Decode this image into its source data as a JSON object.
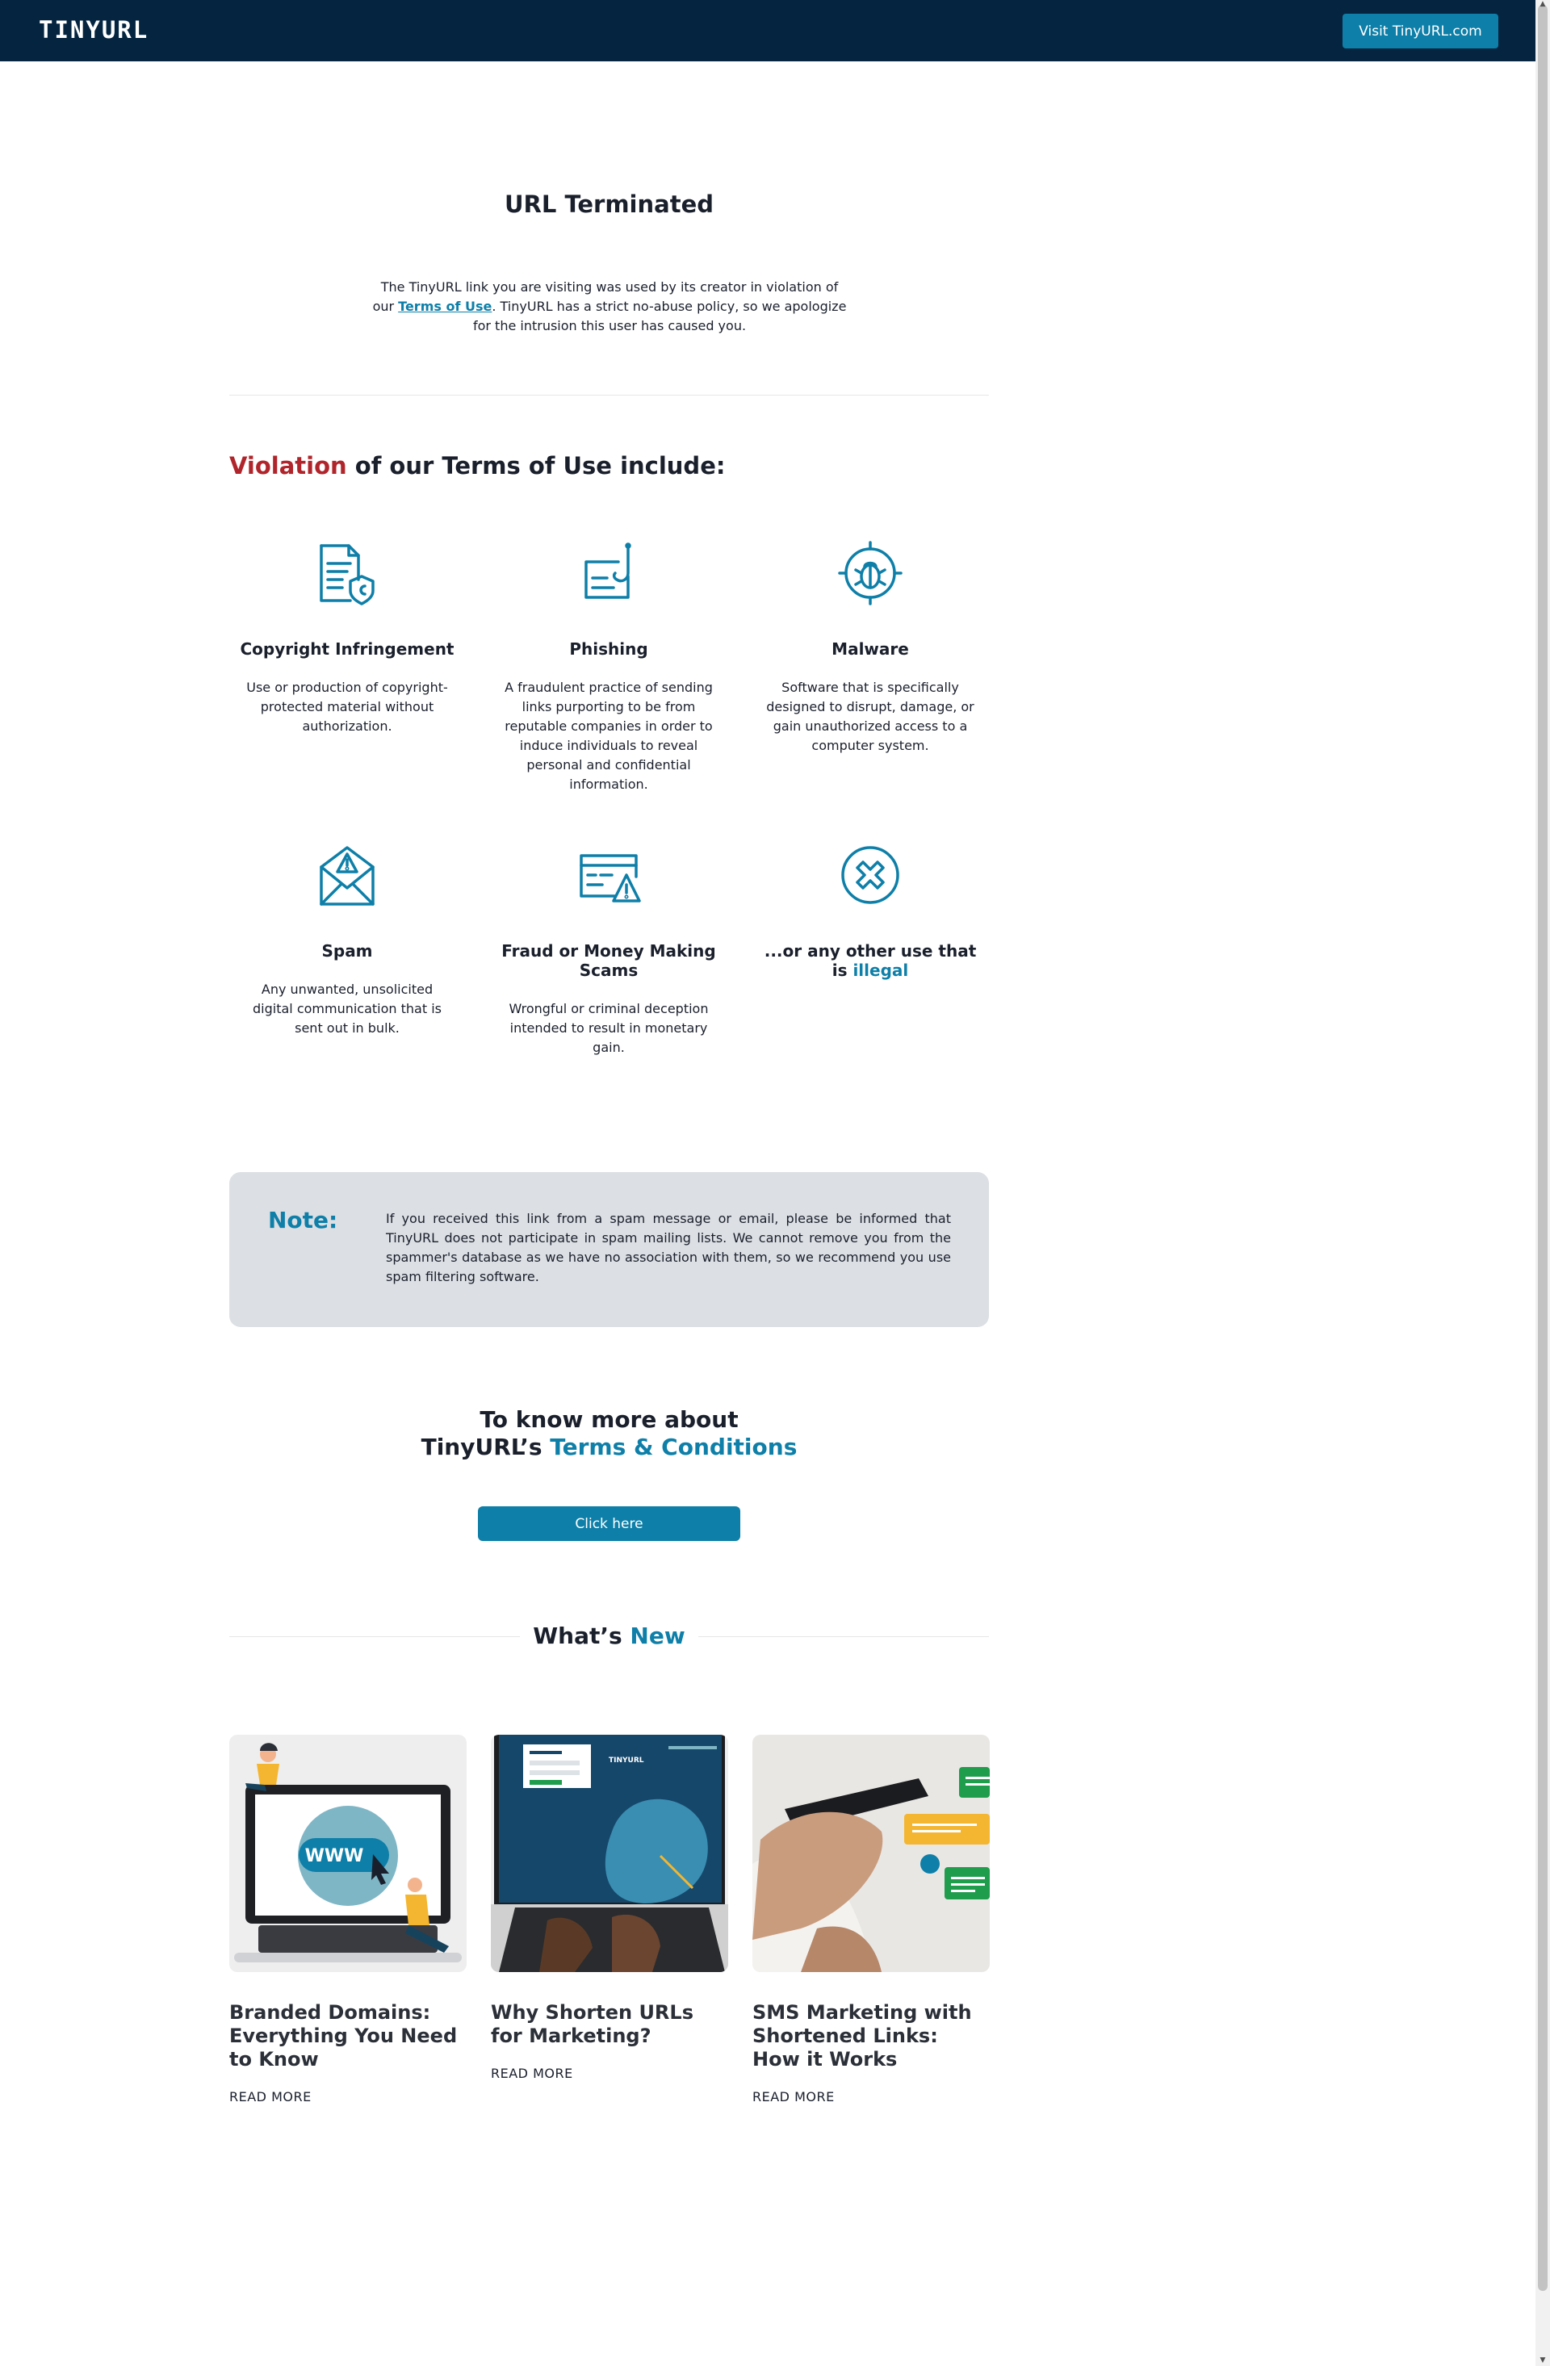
{
  "header": {
    "logo": "TINYURL",
    "visit_button": "Visit TinyURL.com"
  },
  "main": {
    "title": "URL Terminated",
    "intro_before": "The TinyURL link you are visiting was used by its creator in violation of our ",
    "intro_link": "Terms of Use",
    "intro_after": ". TinyURL has a strict no-abuse policy, so we apologize for the intrusion this user has caused you."
  },
  "violations": {
    "heading_highlight": "Violation",
    "heading_rest": " of our Terms of Use include:",
    "items": [
      {
        "title": "Copyright Infringement",
        "desc": "Use or production of copyright-protected material without authorization.",
        "icon": "copyright-document-icon"
      },
      {
        "title": "Phishing",
        "desc": "A fraudulent practice of sending links purporting to be from reputable companies in order to induce individuals to reveal personal and confidential information.",
        "icon": "fishing-hook-card-icon"
      },
      {
        "title": "Malware",
        "desc": "Software that is specifically designed to disrupt, damage, or gain unauthorized access to a computer system.",
        "icon": "bug-target-icon"
      },
      {
        "title": "Spam",
        "desc": "Any unwanted, unsolicited digital communication that is sent out in bulk.",
        "icon": "envelope-warning-icon"
      },
      {
        "title": "Fraud or Money Making Scams",
        "desc": "Wrongful or criminal deception intended to result in monetary gain.",
        "icon": "credit-card-warning-icon"
      },
      {
        "title_before": "...or any other use that is ",
        "title_highlight": "illegal",
        "icon": "circle-x-icon"
      }
    ]
  },
  "note": {
    "label": "Note:",
    "text": "If you received this link from a spam message or email, please be informed that TinyURL does not participate in spam mailing lists. We cannot remove you from the spammer's database as we have no association with them, so we recommend you use spam filtering software."
  },
  "terms": {
    "line1": "To know more about",
    "line2_before": "TinyURL’s ",
    "line2_highlight": "Terms & Conditions",
    "button": "Click here"
  },
  "whats_new": {
    "heading_before": "What’s ",
    "heading_highlight": "New",
    "posts": [
      {
        "title": "Branded Domains: Everything You Need to Know",
        "read_more": "READ MORE",
        "image_text": "WWW"
      },
      {
        "title": "Why Shorten URLs for Marketing?",
        "read_more": "READ MORE",
        "image_text": "TINYURL"
      },
      {
        "title": "SMS Marketing with Shortened Links: How it Works",
        "read_more": "READ MORE"
      }
    ]
  },
  "colors": {
    "header_bg": "#042440",
    "accent": "#0e7fa8",
    "violation_red": "#b0252b",
    "note_bg": "#dcdfe3"
  }
}
